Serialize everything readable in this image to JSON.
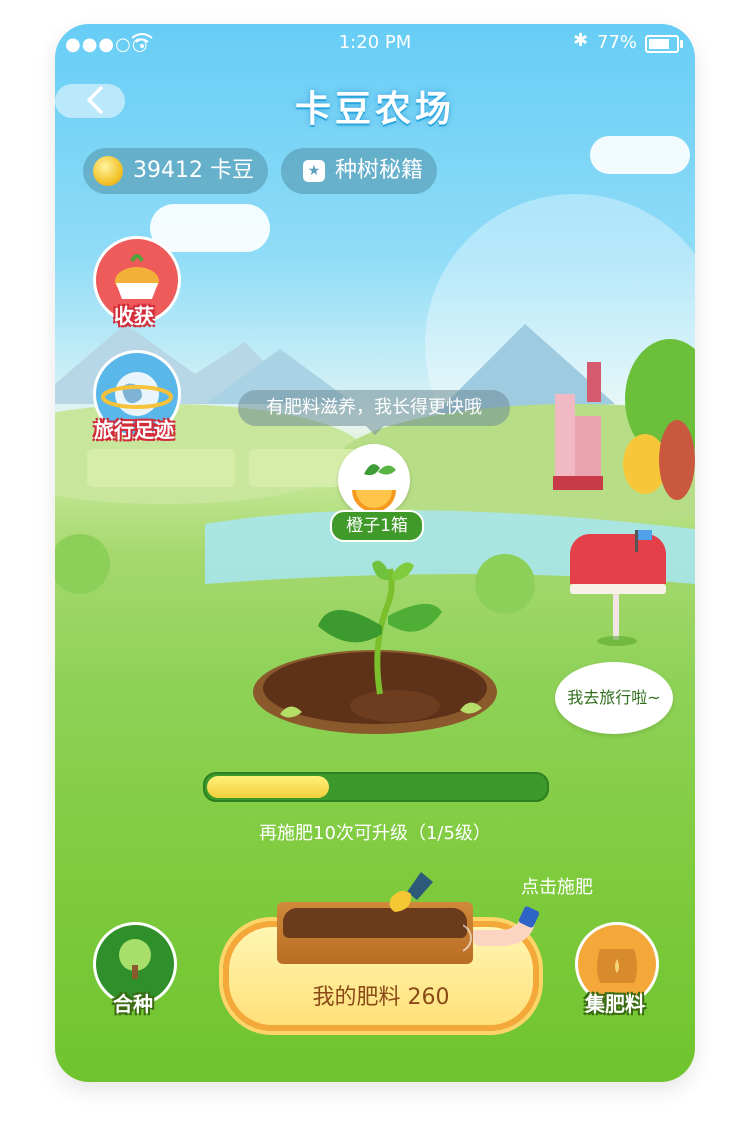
{
  "status_bar": {
    "signal": "●●●○○",
    "time": "1:20 PM",
    "battery_text": "77%",
    "battery_level": 0.77
  },
  "header": {
    "title": "卡豆农场"
  },
  "coins": {
    "amount_label": "39412 卡豆"
  },
  "guide": {
    "label": "种树秘籍"
  },
  "side_buttons": {
    "harvest": "收获",
    "travel": "旅行足迹"
  },
  "tree_bubble": {
    "text": "有肥料滋养，我长得更快哦"
  },
  "reward": {
    "label": "橙子1箱"
  },
  "mailbox_bubble": {
    "text": "我去旅行啦~"
  },
  "progress": {
    "value": 0.36,
    "text": "再施肥10次可升级（1/5级）"
  },
  "fertilizer": {
    "hint": "点击施肥",
    "label": "我的肥料 260"
  },
  "bottom_buttons": {
    "plant": "合种",
    "collect": "集肥料"
  },
  "colors": {
    "progress_fill": "#f2cf3a",
    "progress_track": "#3b9a2b",
    "button_border": "#f5a83a"
  }
}
